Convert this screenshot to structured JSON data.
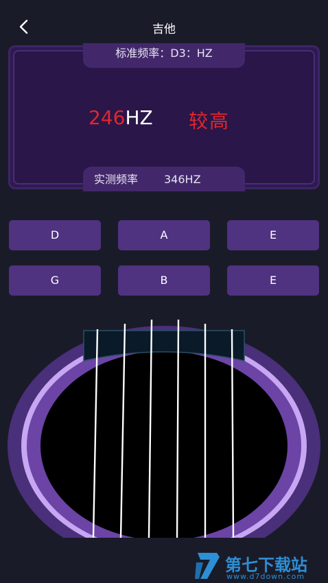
{
  "header": {
    "title": "吉他",
    "back_icon": "chevron-left-icon"
  },
  "panel": {
    "standard_label": "标准频率：D3：HZ",
    "current_freq_value": "246",
    "current_freq_unit": "HZ",
    "status": "较高",
    "measured_label": "实测频率",
    "measured_value": "346HZ"
  },
  "strings": {
    "row1": [
      "D",
      "A",
      "E"
    ],
    "row2": [
      "G",
      "B",
      "E"
    ]
  },
  "colors": {
    "accent_red": "#e2262c",
    "button_bg": "#4f3280",
    "background": "#1a1b29"
  },
  "watermark": {
    "name": "第七下载站",
    "url": "www.d7down.com"
  }
}
